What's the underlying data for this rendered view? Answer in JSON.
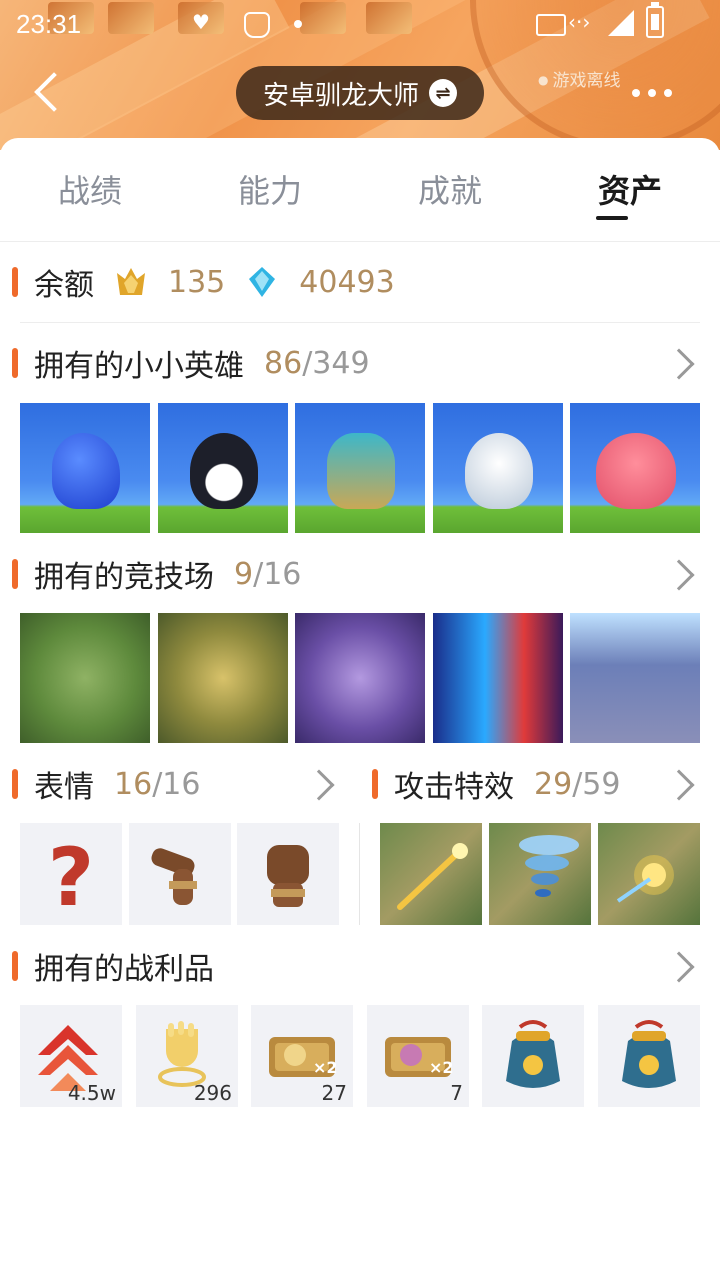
{
  "status_bar": {
    "time": "23:31"
  },
  "header": {
    "player_name": "安卓驯龙大师",
    "status": "游戏离线",
    "swap_icon": "swap-icon",
    "back_icon": "back-icon",
    "more_icon": "more-icon"
  },
  "tabs": [
    {
      "label": "战绩",
      "active": false
    },
    {
      "label": "能力",
      "active": false
    },
    {
      "label": "成就",
      "active": false
    },
    {
      "label": "资产",
      "active": true
    }
  ],
  "balance": {
    "label": "余额",
    "currency1": {
      "icon": "gold-crown-icon",
      "value": "135"
    },
    "currency2": {
      "icon": "blue-gem-icon",
      "value": "40493"
    }
  },
  "heroes": {
    "label": "拥有的小小英雄",
    "owned": "86",
    "total": "/349",
    "items": [
      {
        "icon": "blue-slime-hero",
        "color": "#1e3fcf"
      },
      {
        "icon": "penguin-hero",
        "color": "#1d1f2a"
      },
      {
        "icon": "dragon-hero",
        "color": "#3db7c9"
      },
      {
        "icon": "white-tiger-hero",
        "color": "#e9eef4"
      },
      {
        "icon": "pink-cat-hero",
        "color": "#f26a7c"
      }
    ]
  },
  "arenas": {
    "label": "拥有的竞技场",
    "owned": "9",
    "total": "/16",
    "items": [
      {
        "icon": "jungle-arena",
        "color": "#5e8a3c"
      },
      {
        "icon": "golden-jungle-arena",
        "color": "#8f8a3e"
      },
      {
        "icon": "purple-swirl-arena",
        "color": "#6a4fa6"
      },
      {
        "icon": "neon-dragon-arena",
        "color": "#1a2d8a"
      },
      {
        "icon": "sky-temple-arena",
        "color": "#6c7fb8"
      }
    ]
  },
  "emotes": {
    "label": "表情",
    "owned": "16",
    "total": "/16",
    "items": [
      {
        "icon": "question-mark-emote"
      },
      {
        "icon": "arm-emote"
      },
      {
        "icon": "fist-emote"
      }
    ]
  },
  "attack_effects": {
    "label": "攻击特效",
    "owned": "29",
    "total": "/59",
    "items": [
      {
        "icon": "golden-spear-effect"
      },
      {
        "icon": "tornado-effect"
      },
      {
        "icon": "spark-effect"
      }
    ]
  },
  "loot": {
    "label": "拥有的战利品",
    "items": [
      {
        "icon": "red-rank-chevron-icon",
        "count": "4.5w"
      },
      {
        "icon": "golden-hand-icon",
        "count": "296"
      },
      {
        "icon": "gold-ticket-x2-icon",
        "count": "27"
      },
      {
        "icon": "purple-ticket-x2-icon",
        "count": "7"
      },
      {
        "icon": "treasure-bag-icon",
        "count": ""
      },
      {
        "icon": "treasure-bag-icon",
        "count": ""
      }
    ]
  }
}
